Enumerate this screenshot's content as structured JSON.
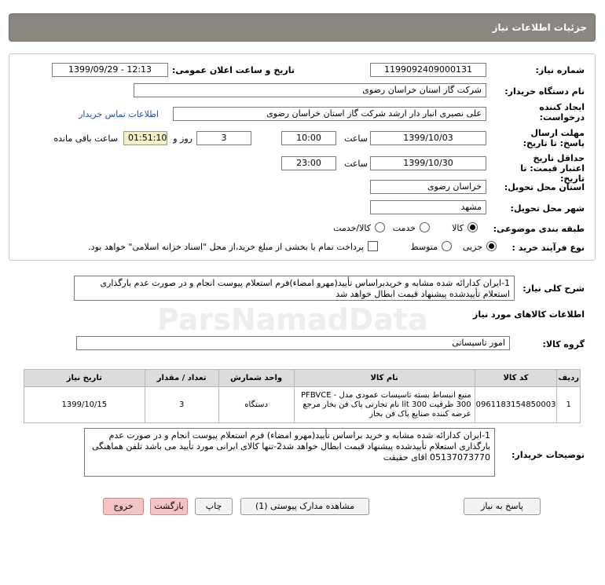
{
  "header": {
    "title": "جزئیات اطلاعات نیاز"
  },
  "form": {
    "need_number_label": "شماره نیاز:",
    "need_number": "1199092409000131",
    "announce_label": "تاریخ و ساعت اعلان عمومی:",
    "announce_value": "1399/09/29 - 12:13",
    "buyer_org_label": "نام دستگاه خریدار:",
    "buyer_org": "شرکت گاز استان خراسان رضوی",
    "requester_label": "ایجاد کننده درخواست:",
    "requester": "علی نصیری انبار دار  ارشد شرکت گاز استان خراسان رضوی",
    "contact_link": "اطلاعات تماس خریدار",
    "deadline_label": "مهلت ارسال پاسخ: تا تاریخ:",
    "deadline_date": "1399/10/03",
    "time_label": "ساعت",
    "deadline_time": "10:00",
    "days_value": "3",
    "days_label": "روز و",
    "timer_value": "01:51:10",
    "remaining_label": "ساعت باقی مانده",
    "validity_label": "حداقل تاریخ اعتبار قیمت: تا تاریخ:",
    "validity_date": "1399/10/30",
    "validity_time": "23:00",
    "province_label": "استان محل تحویل:",
    "province": "خراسان رضوی",
    "city_label": "شهر محل تحویل:",
    "city": "مشهد",
    "category_label": "طبقه بندی موضوعی:",
    "category_options": [
      "کالا",
      "خدمت",
      "کالا/خدمت"
    ],
    "process_label": "نوع فرآیند خرید :",
    "process_options": [
      "جزیی",
      "متوسط"
    ],
    "payment_note": "پرداخت تمام یا بخشی از مبلغ خرید،از محل \"اسناد خزانه اسلامی\" خواهد بود."
  },
  "description": {
    "label": "شرح کلی نیاز:",
    "text": "1-ایران کدارائه شده مشابه و خریدبراساس تأیید(مهرو امضاء)فرم استعلام پیوست انجام و در صورت عدم بارگذاری استعلام تأییدشده پیشنهاد قیمت ابطال خواهد شد"
  },
  "goods": {
    "section_title": "اطلاعات کالاهای مورد نیاز",
    "group_label": "گروه کالا:",
    "group_value": "امور تاسیساتی",
    "columns": [
      "ردیف",
      "کد کالا",
      "نام کالا",
      "واحد شمارش",
      "تعداد / مقدار",
      "تاریخ نیاز"
    ],
    "rows": [
      {
        "index": "1",
        "code": "0961183154850003",
        "name": "منبع انبساط بسته تاسیسات عمودی مدل PFBVCE - 300 ظرفیت 300 lit نام تجارتی پاک فن بخار مرجع عرضه کننده صنایع پاک فن بخار",
        "unit": "دستگاه",
        "qty": "3",
        "date": "1399/10/15"
      }
    ]
  },
  "buyer_notes": {
    "label": "توضیحات خریدار:",
    "text": "1-ایران کدارائه شده مشابه و خرید براساس تأیید(مهرو امضاء) فرم استعلام پیوست انجام و در صورت عدم بارگذاری استعلام تأییدشده پیشنهاد قیمت ابطال خواهد شد2-تنها کالای ایرانی مورد تأیید می باشد تلفن هماهنگی 05137073770 اقای حقیقت"
  },
  "buttons": {
    "reply": "پاسخ به نیاز",
    "attachments": "مشاهده مدارک پیوستی (1)",
    "print": "چاپ",
    "back": "بازگشت",
    "exit": "خروج"
  },
  "colors": {
    "header_bg": "#8b8680",
    "link": "#1f4fa8",
    "timer_bg": "#f4f1c9",
    "danger_btn": "#f4c4c4"
  }
}
